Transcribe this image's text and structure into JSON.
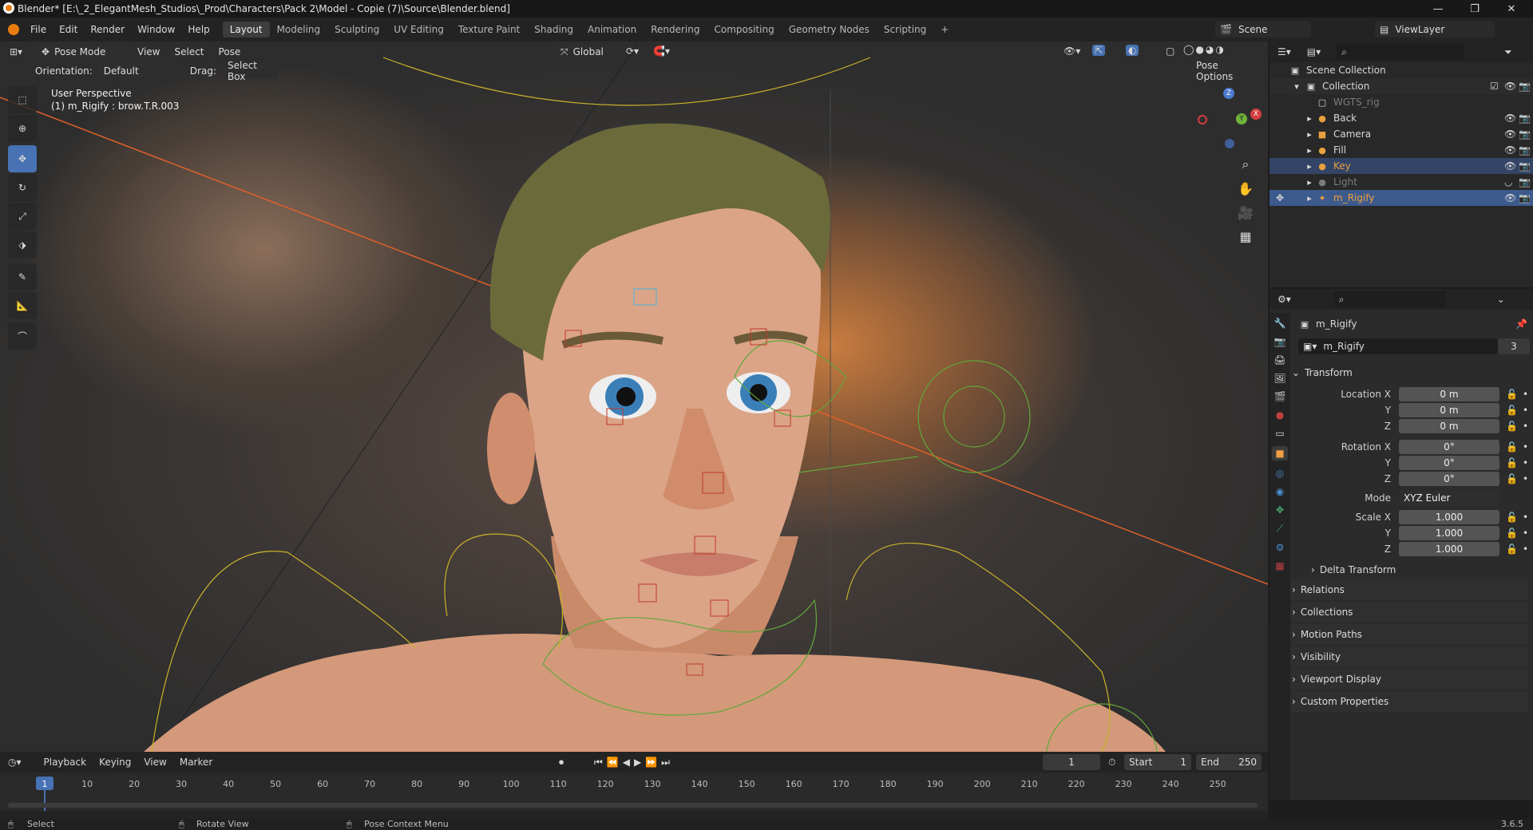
{
  "window": {
    "title": "Blender* [E:\\_2_ElegantMesh_Studios\\_Prod\\Characters\\Pack 2\\Model - Copie (7)\\Source\\Blender.blend]",
    "buttons": [
      "—",
      "❐",
      "✕"
    ]
  },
  "menus": [
    "File",
    "Edit",
    "Render",
    "Window",
    "Help"
  ],
  "workspaces": [
    "Layout",
    "Modeling",
    "Sculpting",
    "UV Editing",
    "Texture Paint",
    "Shading",
    "Animation",
    "Rendering",
    "Compositing",
    "Geometry Nodes",
    "Scripting",
    "+"
  ],
  "scene": {
    "label": "Scene",
    "viewlayer": "ViewLayer"
  },
  "viewport": {
    "mode": "Pose Mode",
    "menus": [
      "View",
      "Select",
      "Pose"
    ],
    "orientation_label": "Orientation:",
    "orientation_value": "Default",
    "drag_label": "Drag:",
    "drag_value": "Select Box",
    "transform_orient": "Global",
    "pose_options": "Pose Options",
    "overlay_line1": "User Perspective",
    "overlay_line2": "(1) m_Rigify : brow.T.R.003",
    "gizmo": {
      "x": "X",
      "y": "Y",
      "z": "Z"
    }
  },
  "outliner": {
    "root": "Scene Collection",
    "collection": "Collection",
    "items": [
      {
        "name": "WGTS_rig",
        "color": "#7c7c7c"
      },
      {
        "name": "Back",
        "color": "#d8d8d8"
      },
      {
        "name": "Camera",
        "color": "#d8d8d8"
      },
      {
        "name": "Fill",
        "color": "#d8d8d8"
      },
      {
        "name": "Key",
        "color": "#e8a040"
      },
      {
        "name": "Light",
        "color": "#7c7c7c"
      },
      {
        "name": "m_Rigify",
        "color": "#f0a040"
      }
    ]
  },
  "properties": {
    "object_name": "m_Rigify",
    "datablock": "m_Rigify",
    "users": "3",
    "transform_title": "Transform",
    "location_label": "Location X",
    "y_label": "Y",
    "z_label": "Z",
    "location": [
      "0 m",
      "0 m",
      "0 m"
    ],
    "rotation_label": "Rotation X",
    "rotation": [
      "0°",
      "0°",
      "0°"
    ],
    "mode_label": "Mode",
    "mode_value": "XYZ Euler",
    "scale_label": "Scale X",
    "scale": [
      "1.000",
      "1.000",
      "1.000"
    ],
    "delta": "Delta Transform",
    "panels": [
      "Relations",
      "Collections",
      "Motion Paths",
      "Visibility",
      "Viewport Display",
      "Custom Properties"
    ]
  },
  "timeline": {
    "menus": [
      "Playback",
      "Keying",
      "View",
      "Marker"
    ],
    "current_frame": "1",
    "start_label": "Start",
    "start": "1",
    "end_label": "End",
    "end": "250",
    "ruler": [
      "1",
      "10",
      "20",
      "30",
      "40",
      "50",
      "60",
      "70",
      "80",
      "90",
      "100",
      "110",
      "120",
      "130",
      "140",
      "150",
      "160",
      "170",
      "180",
      "190",
      "200",
      "210",
      "220",
      "230",
      "240",
      "250"
    ]
  },
  "status": {
    "select": "Select",
    "rotate": "Rotate View",
    "context": "Pose Context Menu",
    "version": "3.6.5"
  }
}
